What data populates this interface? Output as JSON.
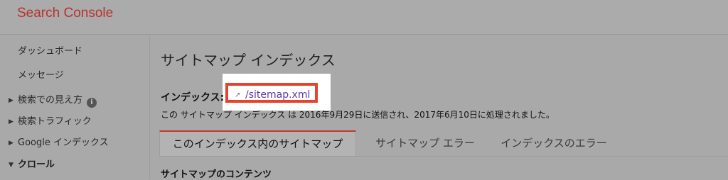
{
  "app": {
    "title": "Search Console"
  },
  "sidebar": {
    "items": [
      {
        "label": "ダッシュボード"
      },
      {
        "label": "メッセージ"
      },
      {
        "label": "検索での見え方"
      },
      {
        "label": "検索トラフィック"
      },
      {
        "label": "Google インデックス"
      },
      {
        "label": "クロール"
      }
    ]
  },
  "main": {
    "title": "サイトマップ インデックス",
    "index_label": "インデックス:",
    "sitemap_link": "/sitemap.xml",
    "status_text": "この サイトマップ インデックス は 2016年9月29日に送信され、2017年6月10日に処理されました。",
    "tabs": [
      {
        "label": "このインデックス内のサイトマップ"
      },
      {
        "label": "サイトマップ エラー"
      },
      {
        "label": "インデックスのエラー"
      }
    ],
    "section_title": "サイトマップのコンテンツ"
  },
  "colors": {
    "brand": "#b8322b",
    "highlight_frame": "#e8412c",
    "link": "#5e35b1"
  }
}
